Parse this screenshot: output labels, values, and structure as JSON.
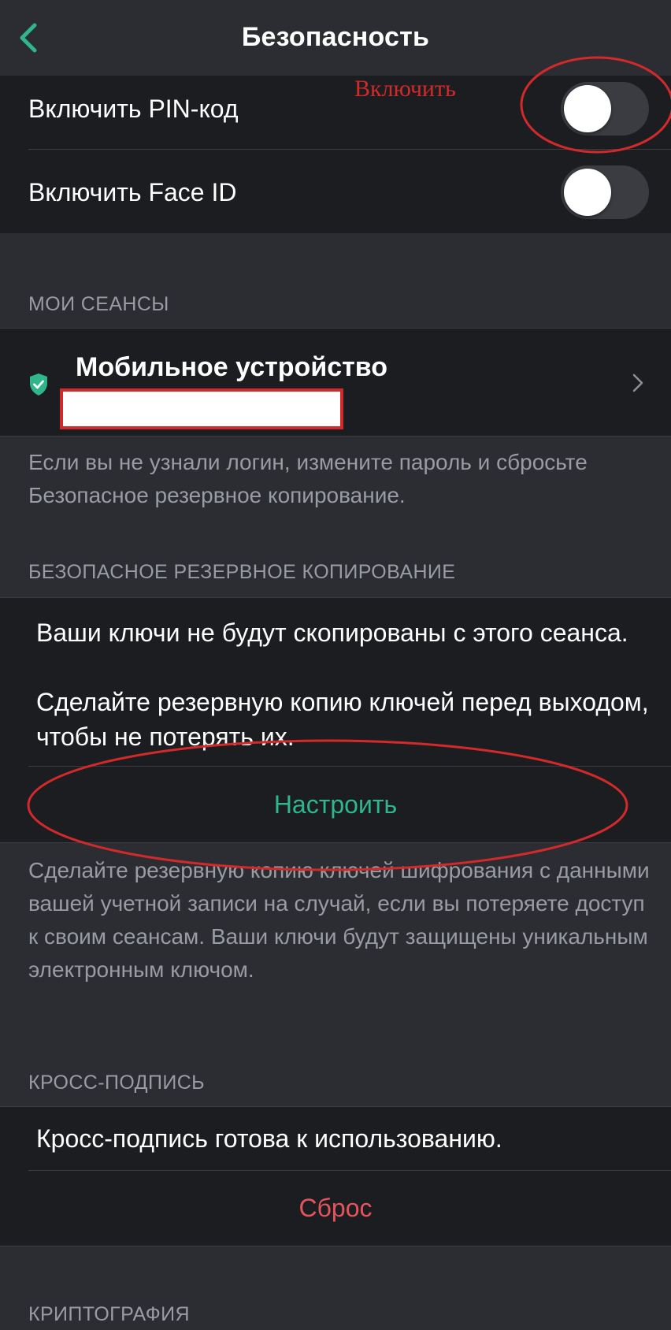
{
  "nav": {
    "title": "Безопасность",
    "back_icon": "chevron-left-icon"
  },
  "security": {
    "pin_label": "Включить PIN-код",
    "pin_enabled": false,
    "faceid_label": "Включить Face ID",
    "faceid_enabled": false
  },
  "sessions": {
    "header": "МОИ СЕАНСЫ",
    "device_name": "Мобильное устройство",
    "device_icon": "shield-check-icon",
    "footer": "Если вы не узнали логин, измените пароль и сбросьте Безопасное резервное копирование."
  },
  "backup": {
    "header": "БЕЗОПАСНОЕ РЕЗЕРВНОЕ КОПИРОВАНИЕ",
    "message_line1": "Ваши ключи не будут скопированы с этого сеанса.",
    "message_line2": "Сделайте резервную копию ключей перед выходом, чтобы не потерять их.",
    "setup_label": "Настроить",
    "footer": "Сделайте резервную копию ключей шифрования с данными вашей учетной записи на случай, если вы потеряете доступ к своим сеансам. Ваши ключи будут защищены уникальным электронным ключом."
  },
  "cross_signing": {
    "header": "КРОСС-ПОДПИСЬ",
    "status": "Кросс-подпись готова к использованию.",
    "reset_label": "Сброс"
  },
  "crypto": {
    "header": "КРИПТОГРАФИЯ"
  },
  "annotation": {
    "label": "Включить"
  },
  "colors": {
    "accent_green": "#2fb68a",
    "danger_red": "#e5545d",
    "annotation_red": "#d22a2a"
  }
}
